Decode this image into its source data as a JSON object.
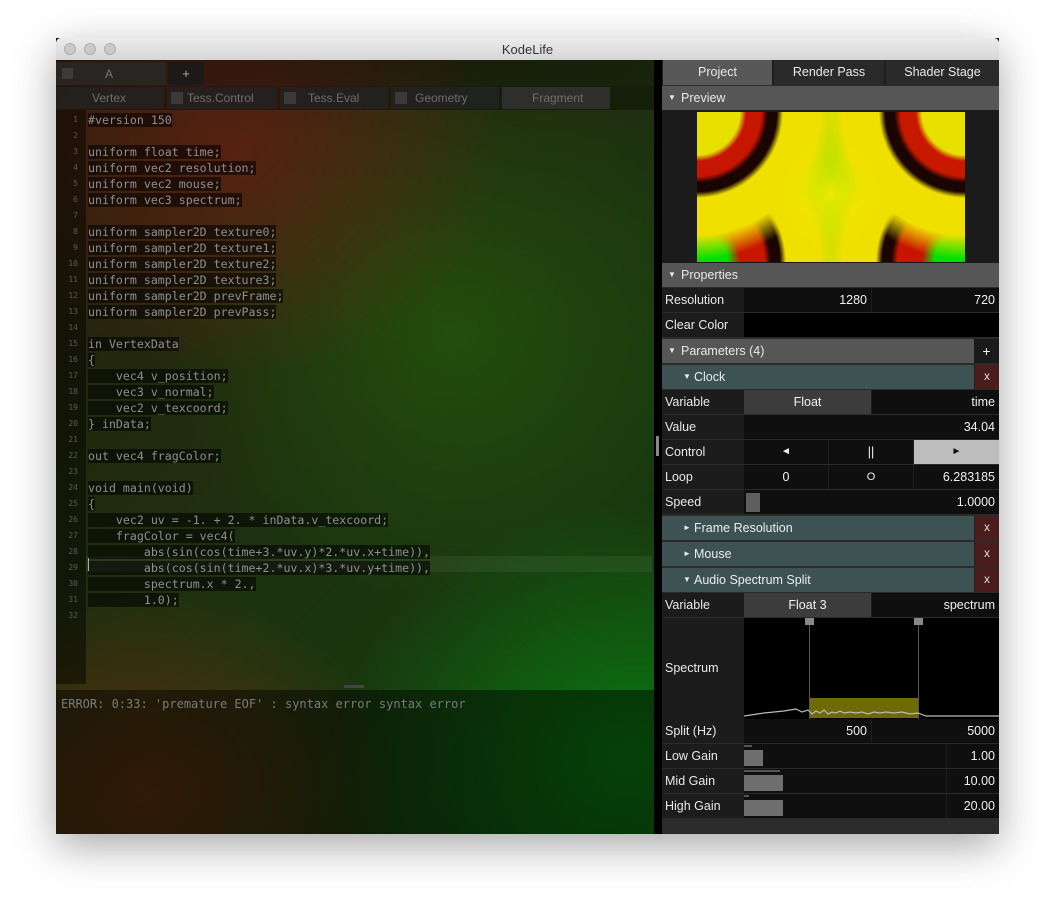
{
  "window": {
    "title": "KodeLife"
  },
  "editor": {
    "tab_label": "A",
    "add_tab": "+",
    "stages": [
      "Vertex",
      "Tess.Control",
      "Tess.Eval",
      "Geometry",
      "Fragment"
    ],
    "lines": [
      "#version 150",
      "",
      "uniform float time;",
      "uniform vec2 resolution;",
      "uniform vec2 mouse;",
      "uniform vec3 spectrum;",
      "",
      "uniform sampler2D texture0;",
      "uniform sampler2D texture1;",
      "uniform sampler2D texture2;",
      "uniform sampler2D texture3;",
      "uniform sampler2D prevFrame;",
      "uniform sampler2D prevPass;",
      "",
      "in VertexData",
      "{",
      "    vec4 v_position;",
      "    vec3 v_normal;",
      "    vec2 v_texcoord;",
      "} inData;",
      "",
      "out vec4 fragColor;",
      "",
      "void main(void)",
      "{",
      "    vec2 uv = -1. + 2. * inData.v_texcoord;",
      "    fragColor = vec4(",
      "        abs(sin(cos(time+3.*uv.y)*2.*uv.x+time)),",
      "        abs(cos(sin(time+2.*uv.x)*3.*uv.y+time)),",
      "        spectrum.x * 2.,",
      "        1.0);",
      ""
    ],
    "line_numbers": [
      "1",
      "2",
      "3",
      "4",
      "5",
      "6",
      "7",
      "8",
      "9",
      "10",
      "11",
      "12",
      "13",
      "14",
      "15",
      "16",
      "17",
      "18",
      "19",
      "20",
      "21",
      "22",
      "23",
      "24",
      "25",
      "26",
      "27",
      "28",
      "29",
      "30",
      "31",
      "32"
    ],
    "error": "ERROR: 0:33: 'premature EOF' : syntax error syntax error"
  },
  "panel": {
    "tabs": [
      "Project",
      "Render Pass",
      "Shader Stage"
    ],
    "preview_header": "Preview",
    "properties_header": "Properties",
    "resolution": {
      "label": "Resolution",
      "width": "1280",
      "height": "720"
    },
    "clear_color": {
      "label": "Clear Color"
    },
    "parameters_header": "Parameters (4)",
    "add": "+",
    "clock": {
      "title": "Clock",
      "close": "x",
      "variable_label": "Variable",
      "type": "Float",
      "name": "time",
      "value_label": "Value",
      "value": "34.04",
      "control_label": "Control",
      "rewind": "◄",
      "pause": "||",
      "play": "►",
      "loop_label": "Loop",
      "loop_start": "0",
      "loop_mode": "O",
      "loop_end": "6.283185",
      "speed_label": "Speed",
      "speed": "1.0000"
    },
    "frame_resolution": {
      "title": "Frame Resolution",
      "close": "x"
    },
    "mouse": {
      "title": "Mouse",
      "close": "x"
    },
    "audio": {
      "title": "Audio Spectrum Split",
      "close": "x",
      "variable_label": "Variable",
      "type": "Float 3",
      "name": "spectrum",
      "spectrum_label": "Spectrum",
      "split_label": "Split (Hz)",
      "split_low": "500",
      "split_high": "5000",
      "low_gain_label": "Low Gain",
      "low_gain": "1.00",
      "mid_gain_label": "Mid Gain",
      "mid_gain": "10.00",
      "high_gain_label": "High Gain",
      "high_gain": "20.00"
    }
  }
}
